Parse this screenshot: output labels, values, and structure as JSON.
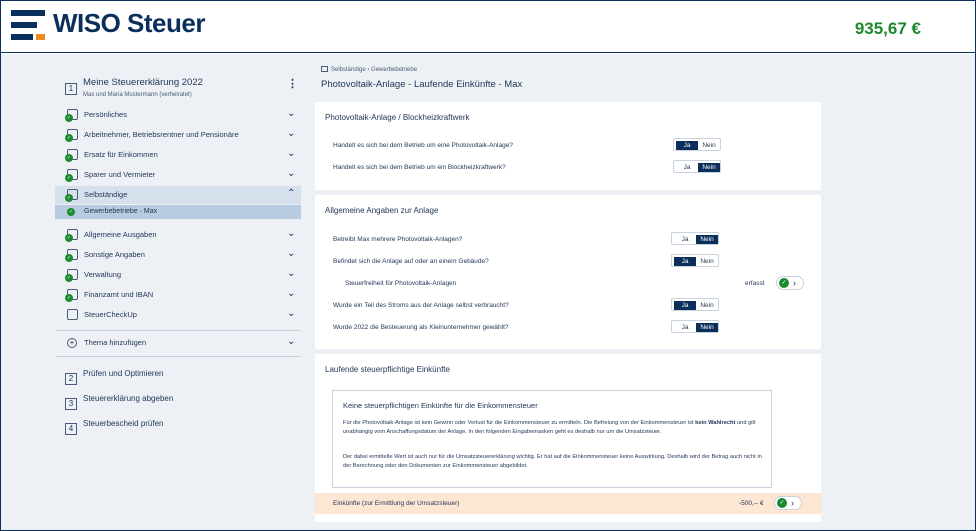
{
  "header": {
    "brand": "WISO Steuer",
    "refund_amount": "935,67 €"
  },
  "sidebar": {
    "step1": {
      "number": "1",
      "title": "Meine Steuererklärung 2022",
      "subtitle": "Max und Maria Mustermann (verheiratet)"
    },
    "items": [
      {
        "label": "Persönliches",
        "icon": "person-icon"
      },
      {
        "label": "Arbeitnehmer, Betriebsrentner und Pensionäre",
        "icon": "briefcase-icon"
      },
      {
        "label": "Ersatz für Einkommen",
        "icon": "hand-money-icon"
      },
      {
        "label": "Sparer und Vermieter",
        "icon": "piggy-bank-icon"
      },
      {
        "label": "Selbständige",
        "icon": "shop-icon"
      },
      {
        "label": "Allgemeine Ausgaben",
        "icon": "receipt-icon"
      },
      {
        "label": "Sonstige Angaben",
        "icon": "document-icon"
      },
      {
        "label": "Verwaltung",
        "icon": "grid-icon"
      },
      {
        "label": "Finanzamt und IBAN",
        "icon": "bank-icon"
      },
      {
        "label": "SteuerCheckUp",
        "icon": "magnifier-icon"
      }
    ],
    "sub_item": "Gewerbebetriebe · Max",
    "add_topic": "Thema hinzufügen",
    "steps": [
      {
        "number": "2",
        "label": "Prüfen und Optimieren"
      },
      {
        "number": "3",
        "label": "Steuererklärung abgeben"
      },
      {
        "number": "4",
        "label": "Steuerbescheid prüfen"
      }
    ]
  },
  "main": {
    "breadcrumb": "Selbständige  ›  Gewerbebetriebe",
    "title": "Photovoltaik-Anlage - Laufende Einkünfte - Max",
    "ja": "Ja",
    "nein": "Nein",
    "card1": {
      "title": "Photovoltaik-Anlage / Blockheizkraftwerk",
      "questions": [
        {
          "text": "Handelt es sich bei dem Betrieb um eine Photovoltaik-Anlage?",
          "selected": "Ja"
        },
        {
          "text": "Handelt es sich bei dem Betrieb um ein Blockheizkraftwerk?",
          "selected": "Nein"
        }
      ]
    },
    "card2": {
      "title": "Allgemeine Angaben zur Anlage",
      "questions": [
        {
          "text": "Betreibt Max mehrere Photovoltaik-Anlagen?",
          "selected": "Nein"
        },
        {
          "text": "Befindet sich die Anlage auf oder an einem Gebäude?",
          "selected": "Ja"
        }
      ],
      "steuerfreiheit": {
        "label": "Steuerfreiheit für Photovoltaik-Anlagen",
        "status": "erfasst"
      },
      "questions2": [
        {
          "text": "Wurde ein Teil des Stroms aus der Anlage selbst verbraucht?",
          "selected": "Ja"
        },
        {
          "text": "Wurde 2022 die Besteuerung als Kleinunternehmer gewählt?",
          "selected": "Nein"
        }
      ]
    },
    "card3": {
      "title": "Laufende steuerpflichtige Einkünfte",
      "info_heading": "Keine steuerpflichtigen Einkünfte für die Einkommensteuer",
      "info_p1_a": "Für die Photovoltaik-Anlage ist kein Gewinn oder Verlust für die Einkommensteuer zu ermitteln. Die Befreiung von der Einkommensteuer ist ",
      "info_p1_bold": "kein Wahlrecht",
      "info_p1_b": " und gilt unabhängig vom Anschaffungsdatum der Anlage. In den folgenden Eingabemasken geht es deshalb nur um die Umsatzsteuer.",
      "info_p2": "Der dabei ermittelte Wert ist auch nur für die Umsatzsteuererklärung wichtig. Er hat auf die Einkommensteuer keine Auswirkung. Deshalb wird der Betrag auch nicht in der Berechnung oder den Dokumenten zur Einkommensteuer abgebildet.",
      "sum_label": "Einkünfte (zur Ermittlung der Umsatzsteuer)",
      "sum_value": "-500,-- €"
    }
  },
  "colors": {
    "navy": "#0b2f5b",
    "orange": "#f08a24",
    "green": "#1a8a2e",
    "highlight": "#fde6d2"
  }
}
